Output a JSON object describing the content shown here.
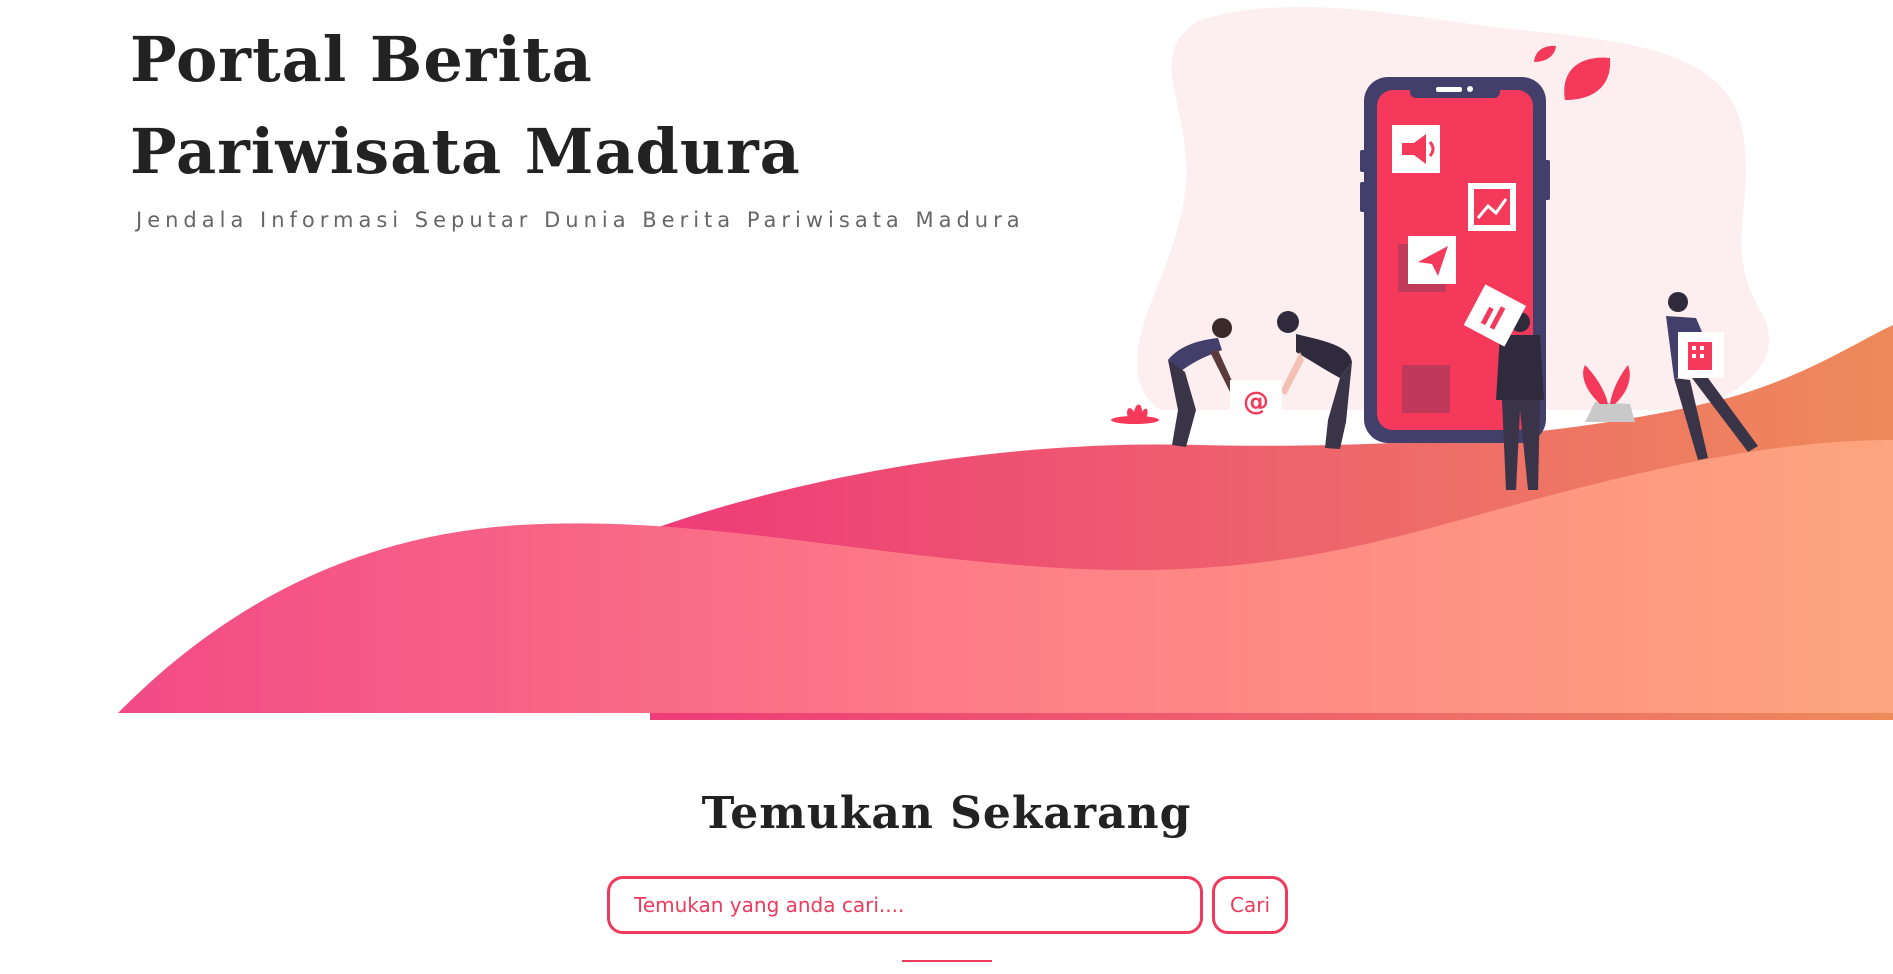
{
  "hero": {
    "title_line1": "Portal Berita",
    "title_line2": "Pariwisata Madura",
    "subtitle": "Jendala Informasi Seputar Dunia Berita Pariwisata Madura"
  },
  "search": {
    "heading": "Temukan Sekarang",
    "placeholder": "Temukan yang anda cari....",
    "button_label": "Cari"
  },
  "illustration": {
    "badge_symbol": "@",
    "icons": [
      "megaphone-icon",
      "chart-icon",
      "paper-plane-icon",
      "document-icon",
      "building-icon"
    ]
  },
  "colors": {
    "accent": "#ee3a5c",
    "wave_start": "#f24a86",
    "wave_end": "#fda57e",
    "phone_frame": "#433f6b",
    "phone_screen": "#f4395a",
    "blob": "#fdeef0",
    "text_dark": "#222222",
    "text_muted": "#666666"
  }
}
